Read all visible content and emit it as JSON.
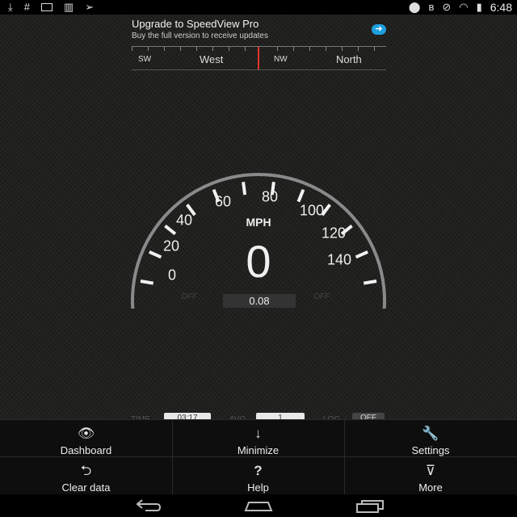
{
  "statusbar": {
    "left_icons": [
      "download-icon",
      "hash-icon",
      "card-icon",
      "barcode-icon",
      "send-icon"
    ],
    "right_icons": [
      "location-icon",
      "bluetooth-off-icon",
      "no-alarm-icon",
      "wifi-icon",
      "battery-icon"
    ],
    "time": "6:48"
  },
  "banner": {
    "title": "Upgrade to SpeedView Pro",
    "subtitle": "Buy the full version to receive updates",
    "action_icon": "arrow-right-icon"
  },
  "compass": {
    "labels": [
      "SW",
      "West",
      "NW",
      "North"
    ]
  },
  "gauge": {
    "unit": "MPH",
    "speed": "0",
    "distance": "0.08",
    "off_left": "OFF",
    "off_right": "OFF",
    "labels": [
      "0",
      "20",
      "40",
      "60",
      "80",
      "100",
      "120",
      "140"
    ]
  },
  "under_menu": {
    "time_label": "TIME",
    "time_value": "03:17",
    "avg_label": "AVG",
    "avg_value": "1",
    "log_label": "LOG",
    "log_value": "OFF"
  },
  "menu": {
    "items": [
      {
        "label": "Dashboard",
        "icon": "eye-icon",
        "glyph": "👁"
      },
      {
        "label": "Minimize",
        "icon": "arrow-down-icon",
        "glyph": "↓"
      },
      {
        "label": "Settings",
        "icon": "wrench-icon",
        "glyph": "🔧"
      },
      {
        "label": "Clear data",
        "icon": "undo-icon",
        "glyph": "⮌"
      },
      {
        "label": "Help",
        "icon": "question-icon",
        "glyph": "?"
      },
      {
        "label": "More",
        "icon": "circle-chevron-down-icon",
        "glyph": "⊽"
      }
    ]
  },
  "navbar": {
    "icons": [
      "back-icon",
      "home-icon",
      "recents-icon"
    ]
  }
}
